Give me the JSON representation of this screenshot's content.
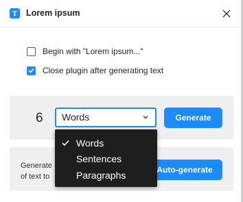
{
  "window": {
    "title": "Lorem ipsum",
    "app_icon_letter": "T"
  },
  "options": {
    "begin_with": {
      "label": "Begin with \"Lorem ipsum...\"",
      "checked": false
    },
    "close_plugin": {
      "label": "Close plugin after generating text",
      "checked": true
    }
  },
  "generate_panel": {
    "count": "6",
    "unit_selected": "Words",
    "generate_label": "Generate"
  },
  "auto_panel": {
    "description_line1": "Generate",
    "description_line2": "of text to",
    "auto_generate_label": "Auto-generate"
  },
  "unit_dropdown": {
    "options": [
      "Words",
      "Sentences",
      "Paragraphs"
    ],
    "selected": "Words"
  },
  "colors": {
    "accent": "#1a8cff",
    "dropdown_bg": "#1e1e1e",
    "panel_bg": "#efefef"
  }
}
